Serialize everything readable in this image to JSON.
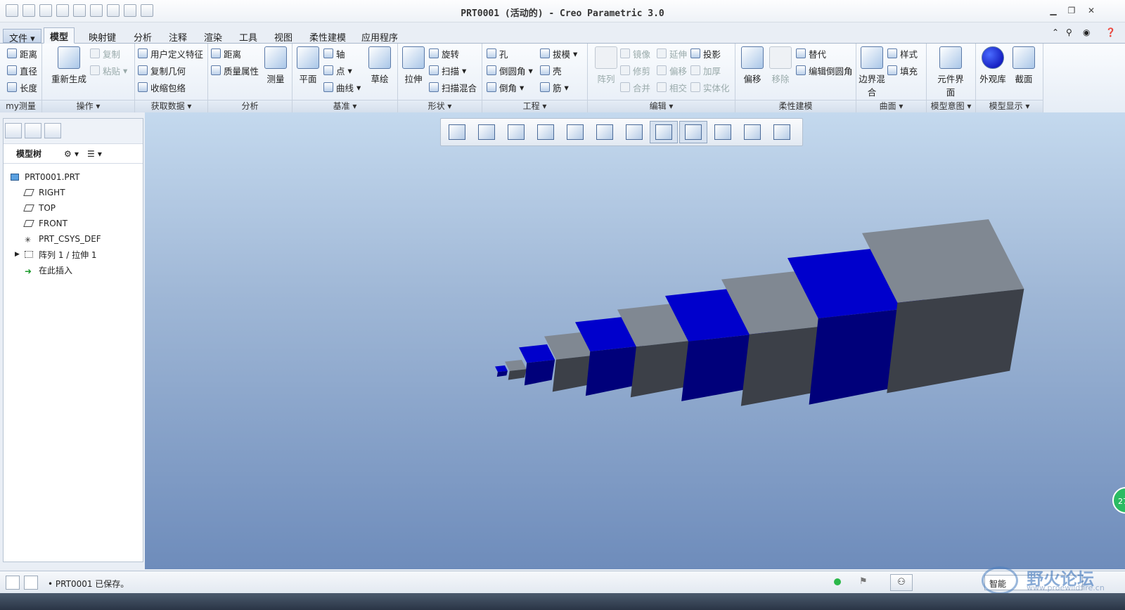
{
  "window": {
    "title": "PRT0001 (活动的) - Creo Parametric 3.0"
  },
  "tabs": [
    {
      "label": "文件",
      "kind": "file"
    },
    {
      "label": "模型",
      "active": true
    },
    {
      "label": "映射键"
    },
    {
      "label": "分析"
    },
    {
      "label": "注释"
    },
    {
      "label": "渲染"
    },
    {
      "label": "工具"
    },
    {
      "label": "视图"
    },
    {
      "label": "柔性建模"
    },
    {
      "label": "应用程序"
    }
  ],
  "ribbon": {
    "groups": [
      {
        "label": "my测量",
        "items": [
          "距离",
          "直径",
          "长度"
        ]
      },
      {
        "label": "操作",
        "items": [
          "重新生成",
          "复制",
          "粘贴"
        ]
      },
      {
        "label": "获取数据",
        "items": [
          "用户定义特征",
          "复制几何",
          "收缩包络"
        ]
      },
      {
        "label": "分析",
        "items": [
          "距离",
          "质量属性",
          "测量"
        ]
      },
      {
        "label": "基准",
        "items": [
          "平面",
          "轴",
          "点",
          "曲线",
          "草绘"
        ]
      },
      {
        "label": "形状",
        "items": [
          "拉伸",
          "旋转",
          "扫描",
          "扫描混合"
        ]
      },
      {
        "label": "工程",
        "items": [
          "孔",
          "倒圆角",
          "倒角",
          "拔模",
          "壳",
          "筋"
        ]
      },
      {
        "label": "编辑",
        "items": [
          "阵列",
          "镜像",
          "修剪",
          "合并",
          "延伸",
          "偏移",
          "相交",
          "投影",
          "加厚",
          "实体化"
        ]
      },
      {
        "label": "柔性建模",
        "items": [
          "偏移",
          "移除",
          "替代",
          "编辑倒圆角"
        ]
      },
      {
        "label": "曲面",
        "items": [
          "边界混合",
          "样式",
          "填充"
        ]
      },
      {
        "label": "模型意图",
        "items": [
          "元件界面"
        ]
      },
      {
        "label": "模型显示",
        "items": [
          "外观库",
          "截面"
        ]
      }
    ]
  },
  "left_panel": {
    "header": "模型树",
    "tree": [
      "PRT0001.PRT",
      "RIGHT",
      "TOP",
      "FRONT",
      "PRT_CSYS_DEF",
      "阵列 1 / 拉伸 1",
      "在此插入"
    ]
  },
  "viewport": {
    "background_top": "#c4d9ee",
    "background_bottom": "#6e8cbb",
    "model_colors": {
      "blue": "#0000cc",
      "grey": "#808892",
      "dark": "#3c4048"
    }
  },
  "status": {
    "message": "PRT0001 已保存。",
    "filter": "智能"
  },
  "watermark": {
    "text": "野火论坛",
    "url": "www.proewildfire.cn"
  },
  "badge": {
    "text": "27"
  }
}
